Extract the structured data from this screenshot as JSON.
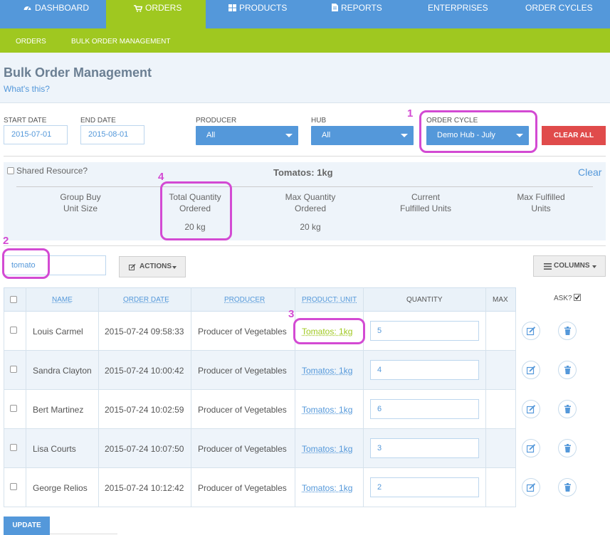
{
  "nav": {
    "tabs": [
      {
        "label": "DASHBOARD",
        "icon": "dashboard-icon"
      },
      {
        "label": "ORDERS",
        "icon": "cart-icon"
      },
      {
        "label": "PRODUCTS",
        "icon": "grid-icon"
      },
      {
        "label": "REPORTS",
        "icon": "document-icon"
      },
      {
        "label": "ENTERPRISES"
      },
      {
        "label": "ORDER CYCLES"
      }
    ],
    "active": "ORDERS",
    "subtabs": [
      "ORDERS",
      "BULK ORDER MANAGEMENT"
    ]
  },
  "page": {
    "title": "Bulk Order Management",
    "help_link": "What's this?"
  },
  "filters": {
    "start_date_label": "START DATE",
    "start_date": "2015-07-01",
    "end_date_label": "END DATE",
    "end_date": "2015-08-01",
    "producer_label": "PRODUCER",
    "producer": "All",
    "hub_label": "HUB",
    "hub": "All",
    "order_cycle_label": "ORDER CYCLE",
    "order_cycle": "Demo Hub - July",
    "clear_all": "CLEAR ALL"
  },
  "summary": {
    "shared_label": "Shared Resource?",
    "product": "Tomatos: 1kg",
    "clear": "Clear",
    "group_buy_line1": "Group Buy",
    "group_buy_line2": "Unit Size",
    "total_qty_line1": "Total Quantity",
    "total_qty_line2": "Ordered",
    "total_qty_value": "20 kg",
    "max_qty_line1": "Max Quantity",
    "max_qty_line2": "Ordered",
    "max_qty_value": "20 kg",
    "current_line1": "Current",
    "current_line2": "Fulfilled Units",
    "max_fulfilled_line1": "Max Fulfilled",
    "max_fulfilled_line2": "Units"
  },
  "toolbar": {
    "search_value": "tomato",
    "actions": "ACTIONS",
    "columns": "COLUMNS"
  },
  "table": {
    "headers": {
      "name": "NAME",
      "order_date": "ORDER DATE",
      "producer": "PRODUCER",
      "product_unit": "PRODUCT: UNIT",
      "quantity": "QUANTITY",
      "max": "MAX",
      "ask": "ASK?"
    },
    "rows": [
      {
        "name": "Louis Carmel",
        "date": "2015-07-24 09:58:33",
        "producer": "Producer of Vegetables",
        "product": "Tomatos: 1kg",
        "qty": "5"
      },
      {
        "name": "Sandra Clayton",
        "date": "2015-07-24 10:00:42",
        "producer": "Producer of Vegetables",
        "product": "Tomatos: 1kg",
        "qty": "4"
      },
      {
        "name": "Bert Martinez",
        "date": "2015-07-24 10:02:59",
        "producer": "Producer of Vegetables",
        "product": "Tomatos: 1kg",
        "qty": "6"
      },
      {
        "name": "Lisa Courts",
        "date": "2015-07-24 10:07:50",
        "producer": "Producer of Vegetables",
        "product": "Tomatos: 1kg",
        "qty": "3"
      },
      {
        "name": "George Relios",
        "date": "2015-07-24 10:12:42",
        "producer": "Producer of Vegetables",
        "product": "Tomatos: 1kg",
        "qty": "2"
      }
    ]
  },
  "update_button": "UPDATE",
  "annotations": [
    "1",
    "2",
    "3",
    "4"
  ],
  "colors": {
    "nav_blue": "#5498da",
    "nav_green": "#9fc820",
    "danger": "#e04b4b",
    "annotation": "#d34ad3"
  }
}
